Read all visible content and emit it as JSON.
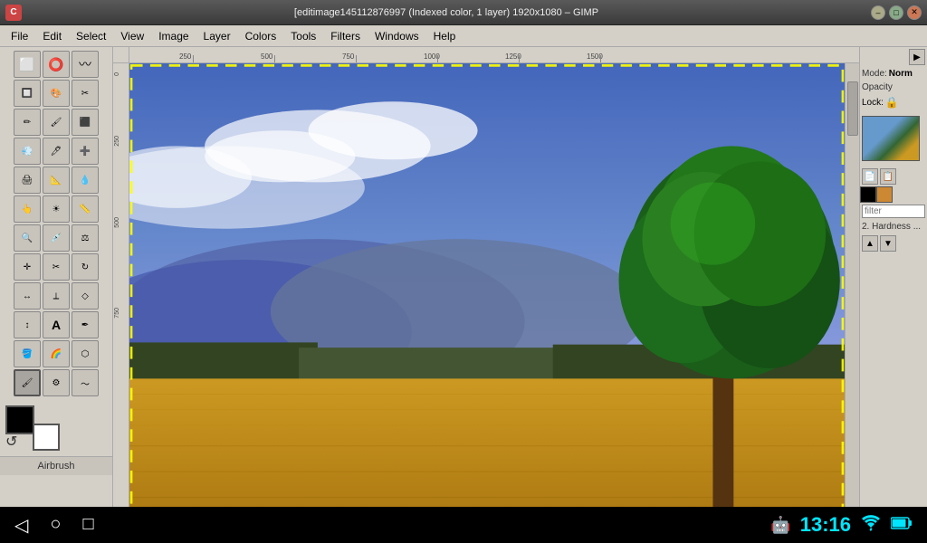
{
  "titlebar": {
    "title": "[editimage145112876997 (Indexed color, 1 layer) 1920x1080 – GIMP",
    "logo_text": "C",
    "close_label": "✕",
    "min_label": "–",
    "max_label": "□"
  },
  "menubar": {
    "items": [
      "File",
      "Edit",
      "Select",
      "View",
      "Image",
      "Layer",
      "Colors",
      "Tools",
      "Filters",
      "Windows",
      "Help"
    ]
  },
  "toolbox": {
    "label": "Airbrush",
    "tools": [
      {
        "row": 1,
        "icons": [
          "⬜",
          "⭕"
        ]
      },
      {
        "row": 2,
        "icons": [
          "⌖",
          "〰"
        ]
      },
      {
        "row": 3,
        "icons": [
          "✂",
          "👁"
        ]
      },
      {
        "row": 4,
        "icons": [
          "🖊",
          "🪣"
        ]
      },
      {
        "row": 5,
        "icons": [
          "🔍",
          "⚙"
        ]
      },
      {
        "row": 6,
        "icons": [
          "✛",
          "↔"
        ]
      },
      {
        "row": 7,
        "icons": [
          "✏",
          "⬛"
        ]
      },
      {
        "row": 8,
        "icons": [
          "A",
          "T"
        ]
      },
      {
        "row": 9,
        "icons": [
          "🔧",
          "⬜"
        ]
      },
      {
        "row": 10,
        "icons": [
          "✏",
          "🔲"
        ]
      },
      {
        "row": 11,
        "icons": [
          "📏",
          "✍"
        ]
      },
      {
        "row": 12,
        "icons": [
          "🖌",
          "❌"
        ]
      },
      {
        "row": 13,
        "icons": [
          "🪣",
          "💧"
        ]
      },
      {
        "row": 14,
        "icons": [
          "🖌",
          "🖊"
        ]
      }
    ],
    "fg_color": "#000000",
    "bg_color": "#ffffff"
  },
  "ruler": {
    "top_marks": [
      "250",
      "500",
      "750",
      "1000",
      "1250",
      "1500"
    ],
    "left_marks": [
      "0",
      "250",
      "500",
      "750"
    ]
  },
  "right_panel": {
    "mode_label": "Mode:",
    "mode_value": "Norm",
    "opacity_label": "Opacity",
    "lock_label": "Lock:",
    "filter_placeholder": "filter",
    "hardness_label": "2. Hardness ...",
    "swatch1": "#000000",
    "swatch2": "#cc8833"
  },
  "statusbar": {
    "time": "13:16",
    "back_icon": "◁",
    "home_icon": "○",
    "recents_icon": "□",
    "wifi_icon": "wifi",
    "battery_icon": "battery"
  },
  "canvas": {
    "dashed_border": true
  }
}
